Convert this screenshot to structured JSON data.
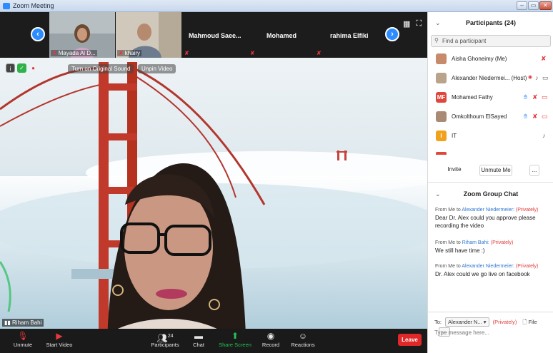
{
  "window": {
    "title": "Zoom Meeting",
    "min": "–",
    "max": "▭",
    "close": "✕"
  },
  "strip": {
    "thumbs": [
      {
        "name": "Mayada Al D..."
      },
      {
        "name": "khairy"
      }
    ],
    "tiles": [
      {
        "name": "Mahmoud  Saee..."
      },
      {
        "name": "Mohamed"
      },
      {
        "name": "rahima Elfiki"
      }
    ],
    "mic_glyph": "✘",
    "prev": "‹",
    "next": "›",
    "grid": "▦",
    "fullscreen": "⛶"
  },
  "video": {
    "turn_on_original_sound": "Turn on Original Sound",
    "unpin_video": "Unpin Video",
    "speaker_name": "Riham Bahi"
  },
  "controls": {
    "unmute": "Unmute",
    "start_video": "Start Video",
    "participants": "Participants",
    "participants_count": "24",
    "chat": "Chat",
    "share_screen": "Share Screen",
    "record": "Record",
    "reactions": "Reactions",
    "leave": "Leave"
  },
  "panel": {
    "title": "Participants (24)",
    "search_placeholder": "Find a participant",
    "participants": [
      {
        "name": "Aisha Ghoneimy (Me)",
        "initials": "",
        "color": "#c78a6b"
      },
      {
        "name": "Alexander Niedermei... (Host)",
        "initials": "",
        "color": "#b9a38a"
      },
      {
        "name": "Mohamed Fathy",
        "initials": "MF",
        "color": "#e0473c"
      },
      {
        "name": "Omkolthoum ElSayed",
        "initials": "",
        "color": "#a98b75"
      },
      {
        "name": "IT",
        "initials": "I",
        "color": "#f0a21d"
      }
    ],
    "invite": "Invite",
    "unmute_me": "Unmute Me",
    "more": "...",
    "chat_title": "Zoom Group Chat",
    "messages": [
      {
        "from": "From Me to",
        "to": "Alexander Niedermeier:",
        "priv": "(Privately)",
        "text": "Dear Dr. Alex  could you approve please recording the video"
      },
      {
        "from": "From Me to",
        "to": "Riham Bahi:",
        "priv": "(Privately)",
        "text": "We still have time :)"
      },
      {
        "from": "From Me to",
        "to": "Alexander Niedermeier:",
        "priv": "(Privately)",
        "text": "Dr. Alex could we go live on facebook"
      }
    ],
    "to_label": "To:",
    "to_value": "Alexander N...",
    "to_priv": "(Privately)",
    "file": "File",
    "type_placeholder": "Type message here..."
  },
  "colors": {
    "accent": "#2d8cff",
    "leave": "#e02828",
    "private": "#e03c3c",
    "share": "#23c552"
  }
}
